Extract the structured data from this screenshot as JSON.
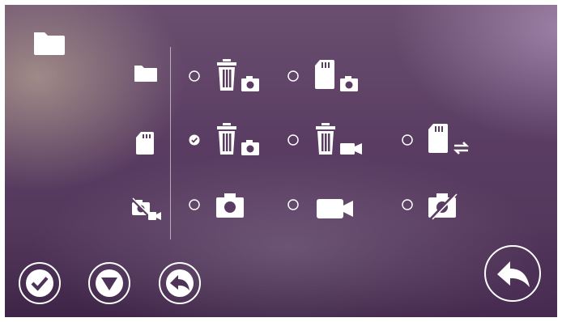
{
  "screen": {
    "title_icon": "folder-icon",
    "rows": [
      {
        "row_icon": "folder-icon",
        "options": [
          {
            "icon": "trash-photo-icon",
            "selected": false
          },
          {
            "icon": "sdcard-photo-icon",
            "selected": false
          }
        ]
      },
      {
        "row_icon": "sdcard-icon",
        "options": [
          {
            "icon": "trash-photo-icon",
            "selected": true
          },
          {
            "icon": "trash-video-icon",
            "selected": false
          },
          {
            "icon": "sdcard-sync-icon",
            "selected": false
          }
        ]
      },
      {
        "row_icon": "record-mode-icon",
        "options": [
          {
            "icon": "camera-icon",
            "selected": false
          },
          {
            "icon": "video-camera-icon",
            "selected": false
          },
          {
            "icon": "camera-off-icon",
            "selected": false
          }
        ]
      }
    ],
    "bottom_buttons": [
      {
        "icon": "checkmark-icon"
      },
      {
        "icon": "triangle-down-icon"
      },
      {
        "icon": "back-arrow-icon"
      }
    ],
    "corner_button": {
      "icon": "back-arrow-icon"
    }
  }
}
